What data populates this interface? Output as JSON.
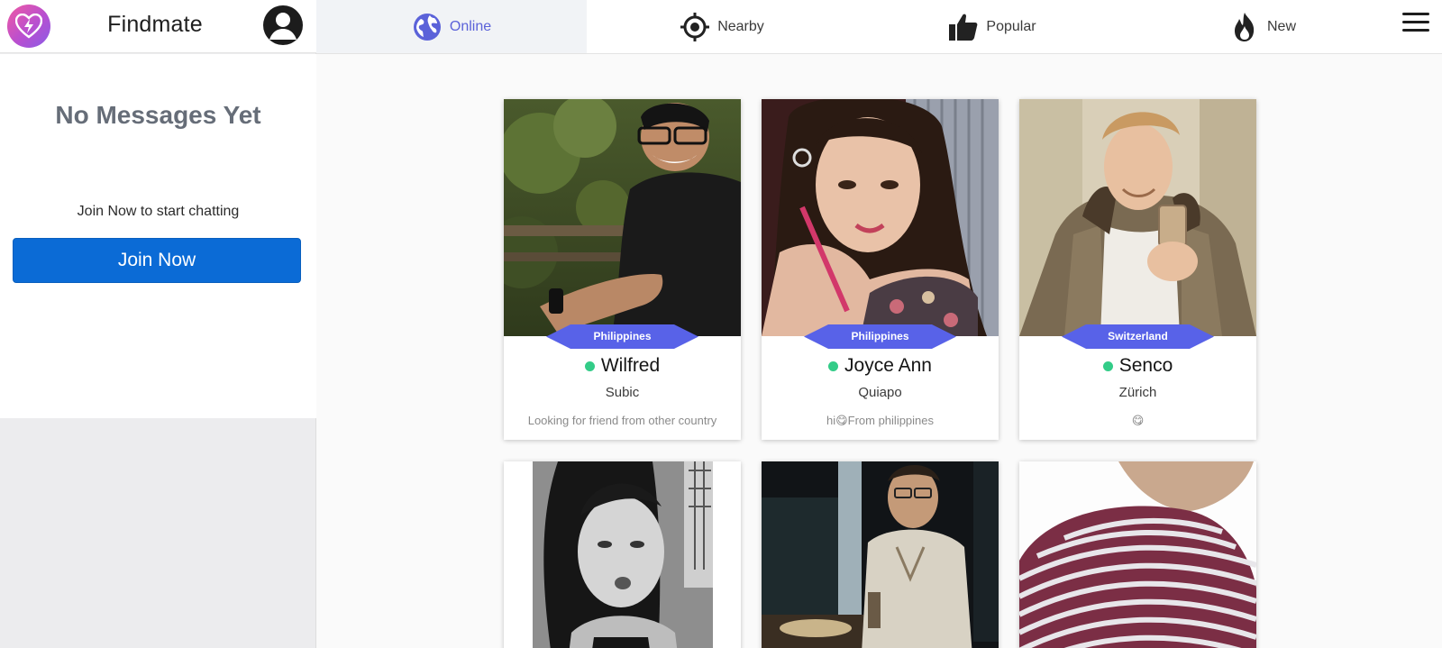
{
  "brand": {
    "name": "Findmate",
    "accent": "#5b62d9"
  },
  "sidebar": {
    "empty_title": "No Messages Yet",
    "join_hint": "Join Now to start chatting",
    "join_button": "Join Now"
  },
  "nav": {
    "tabs": [
      {
        "label": "Online",
        "icon": "globe-icon",
        "active": true
      },
      {
        "label": "Nearby",
        "icon": "crosshair-icon",
        "active": false
      },
      {
        "label": "Popular",
        "icon": "thumbs-up-icon",
        "active": false
      },
      {
        "label": "New",
        "icon": "flame-icon",
        "active": false
      }
    ],
    "menu_icon": "hamburger-menu-icon"
  },
  "profiles": [
    {
      "country": "Philippines",
      "name": "Wilfred",
      "city": "Subic",
      "bio": "Looking for friend from other country",
      "online": true
    },
    {
      "country": "Philippines",
      "name": "Joyce Ann",
      "city": "Quiapo",
      "bio": "hi😋From philippines",
      "online": true
    },
    {
      "country": "Switzerland",
      "name": "Senco",
      "city": "Zürich",
      "bio": "😋",
      "online": true
    },
    {
      "country": "",
      "name": "",
      "city": "",
      "bio": "",
      "online": false
    },
    {
      "country": "",
      "name": "",
      "city": "",
      "bio": "",
      "online": false
    },
    {
      "country": "",
      "name": "",
      "city": "",
      "bio": "",
      "online": false
    }
  ]
}
